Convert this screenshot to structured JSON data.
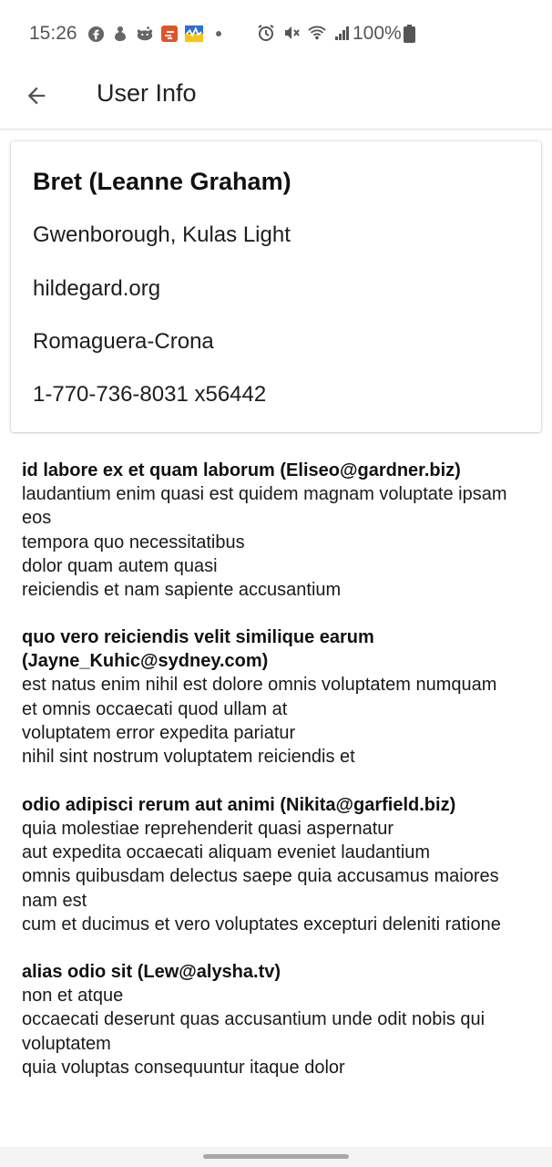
{
  "status_bar": {
    "time": "15:26",
    "battery": "100%",
    "left_icons": [
      "facebook-icon",
      "app-icon",
      "reddit-icon",
      "app-icon",
      "app-icon",
      "dot-icon"
    ],
    "right_icons": [
      "alarm-icon",
      "mute-icon",
      "wifi-icon",
      "signal-icon",
      "battery-icon"
    ]
  },
  "app_bar": {
    "title": "User Info",
    "back_icon": "arrow-back-icon"
  },
  "user": {
    "header": "Bret (Leanne Graham)",
    "address": "Gwenborough, Kulas Light",
    "website": "hildegard.org",
    "company": "Romaguera-Crona",
    "phone": "1-770-736-8031 x56442"
  },
  "posts": [
    {
      "title": "id labore ex et quam laborum (Eliseo@gardner.biz)",
      "body": "laudantium enim quasi est quidem magnam voluptate ipsam eos\ntempora quo necessitatibus\ndolor quam autem quasi\nreiciendis et nam sapiente accusantium"
    },
    {
      "title": "quo vero reiciendis velit similique earum (Jayne_Kuhic@sydney.com)",
      "body": "est natus enim nihil est dolore omnis voluptatem numquam\net omnis occaecati quod ullam at\nvoluptatem error expedita pariatur\nnihil sint nostrum voluptatem reiciendis et"
    },
    {
      "title": "odio adipisci rerum aut animi (Nikita@garfield.biz)",
      "body": "quia molestiae reprehenderit quasi aspernatur\naut expedita occaecati aliquam eveniet laudantium\nomnis quibusdam delectus saepe quia accusamus maiores nam est\ncum et ducimus et vero voluptates excepturi deleniti ratione"
    },
    {
      "title": "alias odio sit (Lew@alysha.tv)",
      "body": "non et atque\noccaecati deserunt quas accusantium unde odit nobis qui voluptatem\nquia voluptas consequuntur itaque dolor"
    }
  ]
}
